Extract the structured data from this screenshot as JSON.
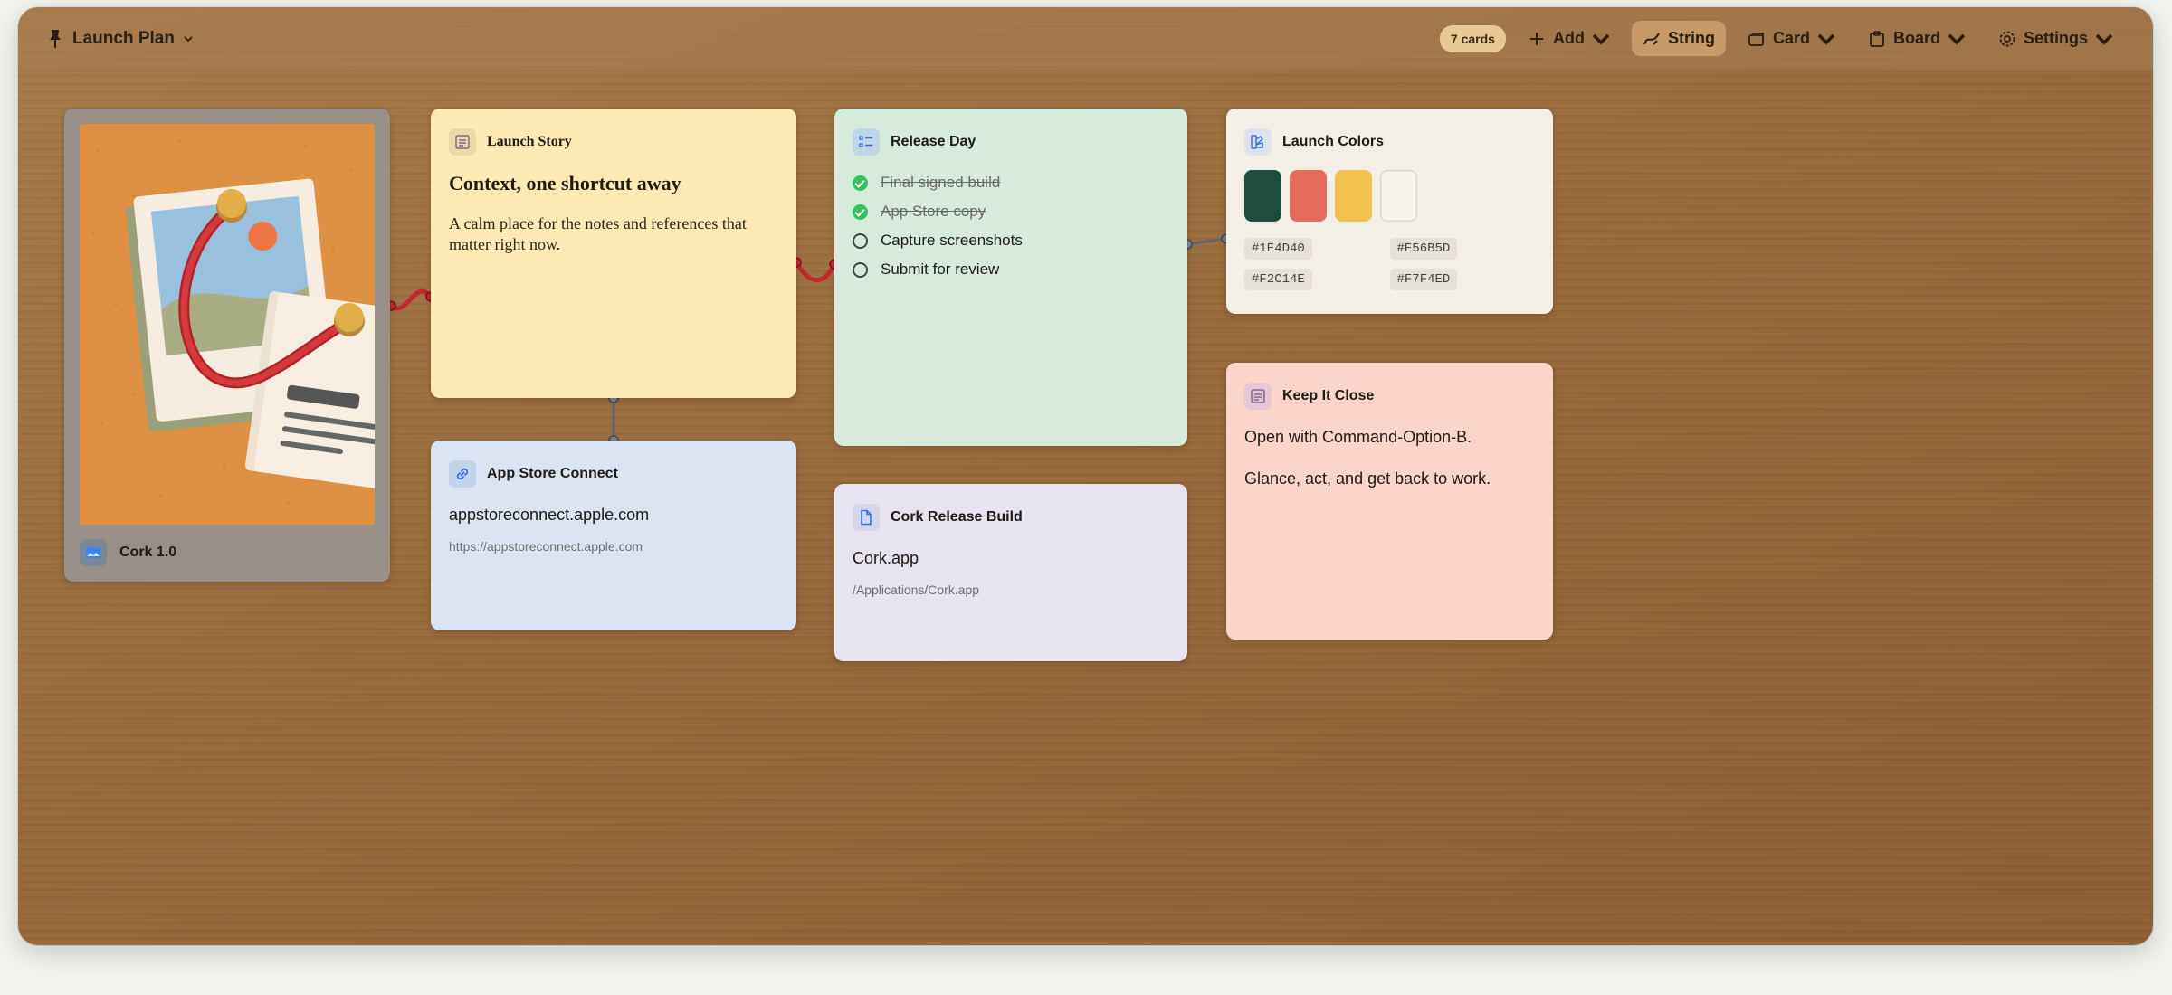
{
  "board": {
    "title": "Launch Plan"
  },
  "toolbar": {
    "card_count": "7 cards",
    "add_label": "Add",
    "string_label": "String",
    "card_label": "Card",
    "board_label": "Board",
    "settings_label": "Settings"
  },
  "cards": {
    "image": {
      "caption": "Cork 1.0"
    },
    "story": {
      "title": "Launch Story",
      "heading": "Context, one shortcut away",
      "body": "A calm place for the notes and references that matter right now."
    },
    "link": {
      "title": "App Store Connect",
      "domain": "appstoreconnect.apple.com",
      "url": "https://appstoreconnect.apple.com"
    },
    "checklist": {
      "title": "Release Day",
      "items": [
        {
          "label": "Final signed build",
          "done": true
        },
        {
          "label": "App Store copy",
          "done": true
        },
        {
          "label": "Capture screenshots",
          "done": false
        },
        {
          "label": "Submit for review",
          "done": false
        }
      ]
    },
    "file": {
      "title": "Cork Release Build",
      "name": "Cork.app",
      "path": "/Applications/Cork.app"
    },
    "colors": {
      "title": "Launch Colors",
      "swatches": [
        "#1E4D40",
        "#E56B5D",
        "#F2C14E",
        "#F7F4ED"
      ],
      "hex_labels": [
        "#1E4D40",
        "#E56B5D",
        "#F2C14E",
        "#F7F4ED"
      ]
    },
    "note": {
      "title": "Keep It Close",
      "line1": "Open with Command-Option-B.",
      "line2": "Glance, act, and get back to work."
    }
  },
  "colors": {
    "string_red": "#c1272d",
    "string_gray": "#5d6570"
  }
}
